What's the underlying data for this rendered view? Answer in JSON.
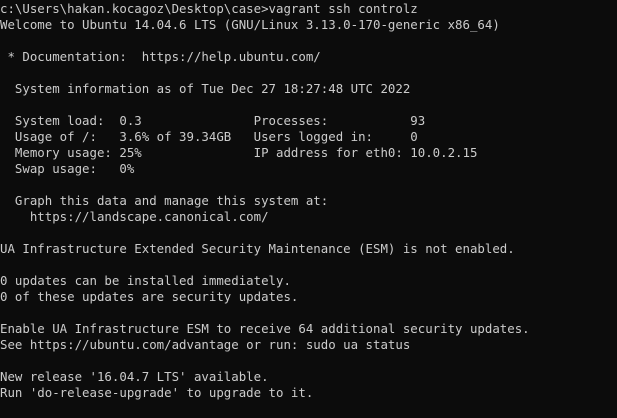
{
  "terminal": {
    "lines": [
      "c:\\Users\\hakan.kocagoz\\Desktop\\case>vagrant ssh controlz",
      "Welcome to Ubuntu 14.04.6 LTS (GNU/Linux 3.13.0-170-generic x86_64)",
      " * Documentation:  https://help.ubuntu.com/",
      "  System information as of Tue Dec 27 18:27:48 UTC 2022",
      "  System load:  0.3               Processes:           93",
      "  Usage of /:   3.6% of 39.34GB   Users logged in:     0",
      "  Memory usage: 25%               IP address for eth0: 10.0.2.15",
      "  Swap usage:   0%",
      "  Graph this data and manage this system at:",
      "    https://landscape.canonical.com/",
      "UA Infrastructure Extended Security Maintenance (ESM) is not enabled.",
      "0 updates can be installed immediately.",
      "0 of these updates are security updates.",
      "Enable UA Infrastructure ESM to receive 64 additional security updates.",
      "See https://ubuntu.com/advantage or run: sudo ua status",
      "New release '16.04.7 LTS' available.",
      "Run 'do-release-upgrade' to upgrade to it."
    ]
  }
}
